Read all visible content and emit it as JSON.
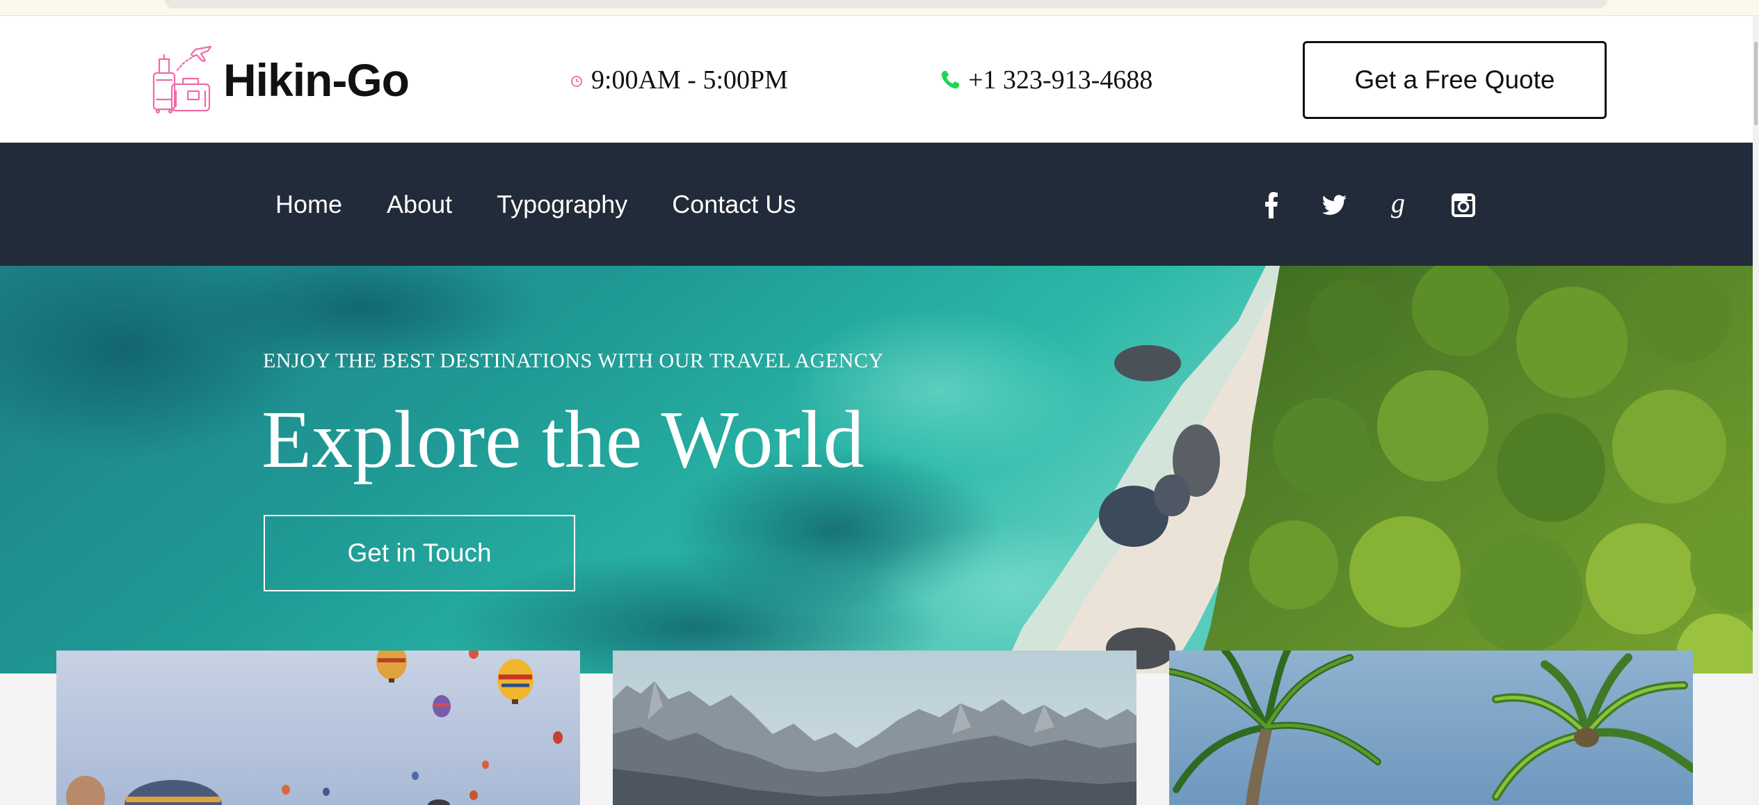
{
  "brand": {
    "name": "Hikin-Go",
    "accent_color": "#f06aa8"
  },
  "header": {
    "hours_icon": "clock-icon",
    "hours": "9:00AM - 5:00PM",
    "phone_icon": "phone-icon",
    "phone_icon_color": "#1fd655",
    "phone": "+1 323-913-4688",
    "quote_button": "Get a Free Quote"
  },
  "nav": {
    "background": "#222b39",
    "links": [
      "Home",
      "About",
      "Typography",
      "Contact Us"
    ],
    "social": [
      "facebook-icon",
      "twitter-icon",
      "google-icon",
      "instagram-icon"
    ]
  },
  "hero": {
    "eyebrow": "ENJOY THE BEST DESTINATIONS WITH OUR TRAVEL AGENCY",
    "title": "Explore the World",
    "button": "Get in Touch"
  },
  "cards": [
    {
      "image": "hot-air-balloons-image"
    },
    {
      "image": "mountain-range-image"
    },
    {
      "image": "palm-trees-image"
    }
  ]
}
